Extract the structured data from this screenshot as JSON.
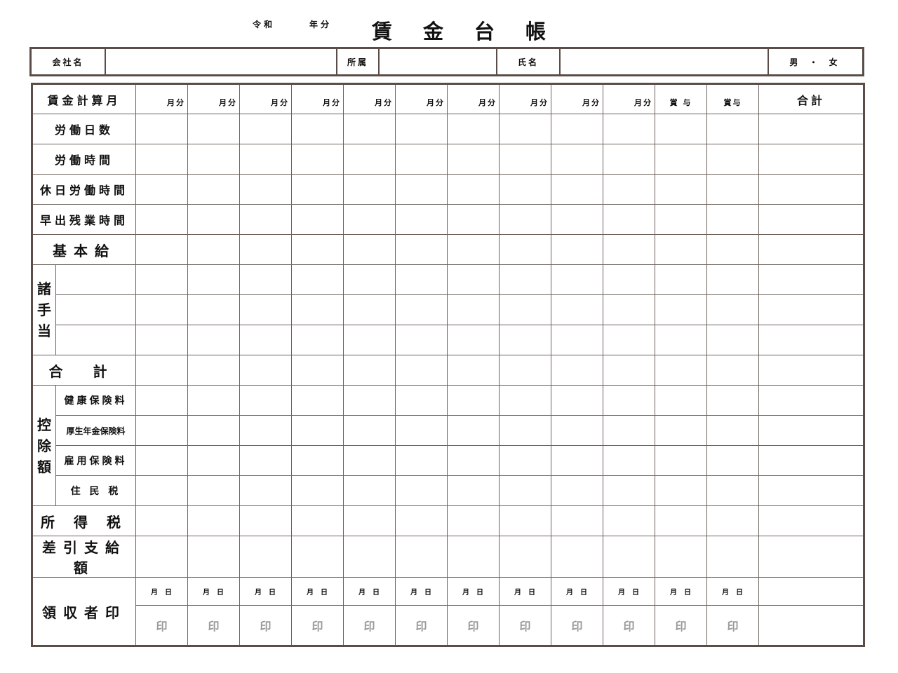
{
  "header": {
    "era": "令和",
    "year_suffix": "年分",
    "title": "賃金台帳"
  },
  "info": {
    "company_label": "会社名",
    "dept_label": "所属",
    "name_label": "氏名",
    "gender_label": "男 ・ 女"
  },
  "table": {
    "month_row_label": "賃金計算月",
    "month_col_label": "月分",
    "bonus_col_label": "賞 与",
    "bonus_col_label2": "賞与",
    "total_col_label": "合計",
    "rows": {
      "work_days": "労働日数",
      "work_hours": "労働時間",
      "holiday_hours": "休日労働時間",
      "overtime_hours": "早出残業時間",
      "base_salary": "基本給",
      "allowances_group": "諸手当",
      "subtotal": "合 計",
      "deductions_group": "控除額",
      "health_ins": "健康保険料",
      "pension_ins": "厚生年金保険料",
      "employment_ins": "雇用保険料",
      "resident_tax": "住 民 税",
      "income_tax": "所 得 税",
      "net_pay": "差引支給額",
      "receipt": "領収者印"
    },
    "receipt_date": "月  日",
    "seal_mark": "印"
  }
}
